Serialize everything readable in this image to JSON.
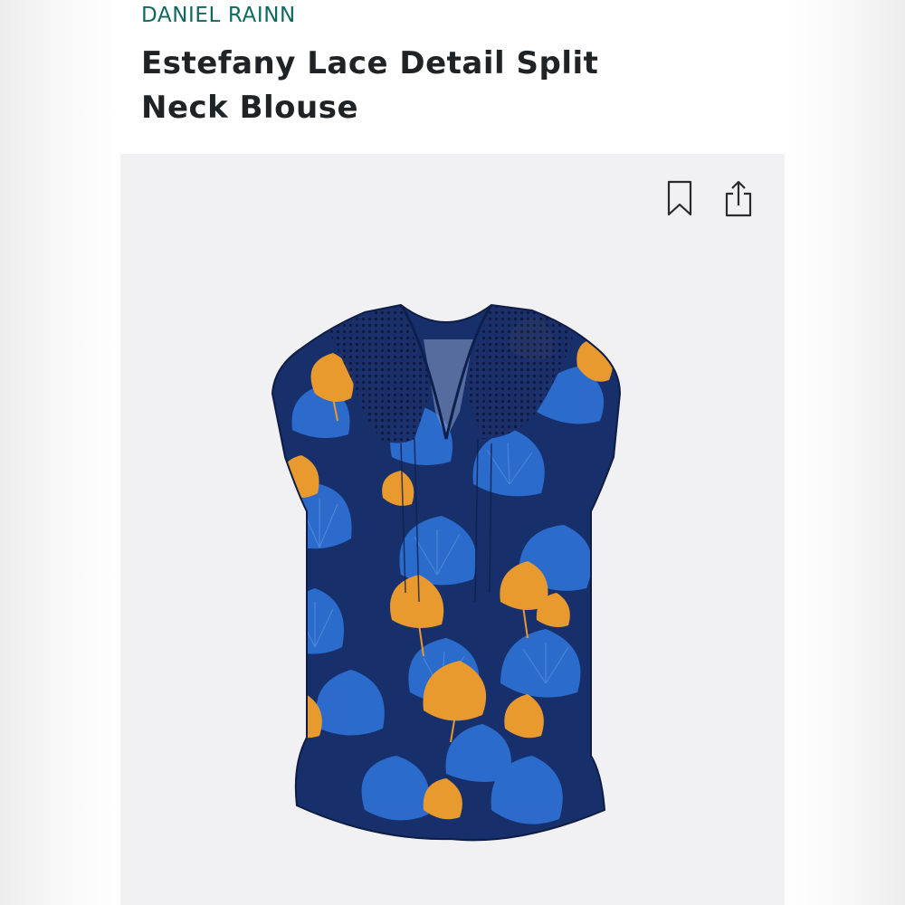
{
  "product": {
    "brand": "DANIEL RAINN",
    "title": "Estefany Lace Detail Split Neck Blouse"
  },
  "icons": {
    "bookmark": "bookmark-icon",
    "share": "share-icon"
  },
  "colors": {
    "brand": "#0f6a5e",
    "title": "#1f2326",
    "fabric_navy": "#16306a",
    "fabric_blue": "#2d6fd1",
    "fabric_orange": "#e89a2e"
  }
}
